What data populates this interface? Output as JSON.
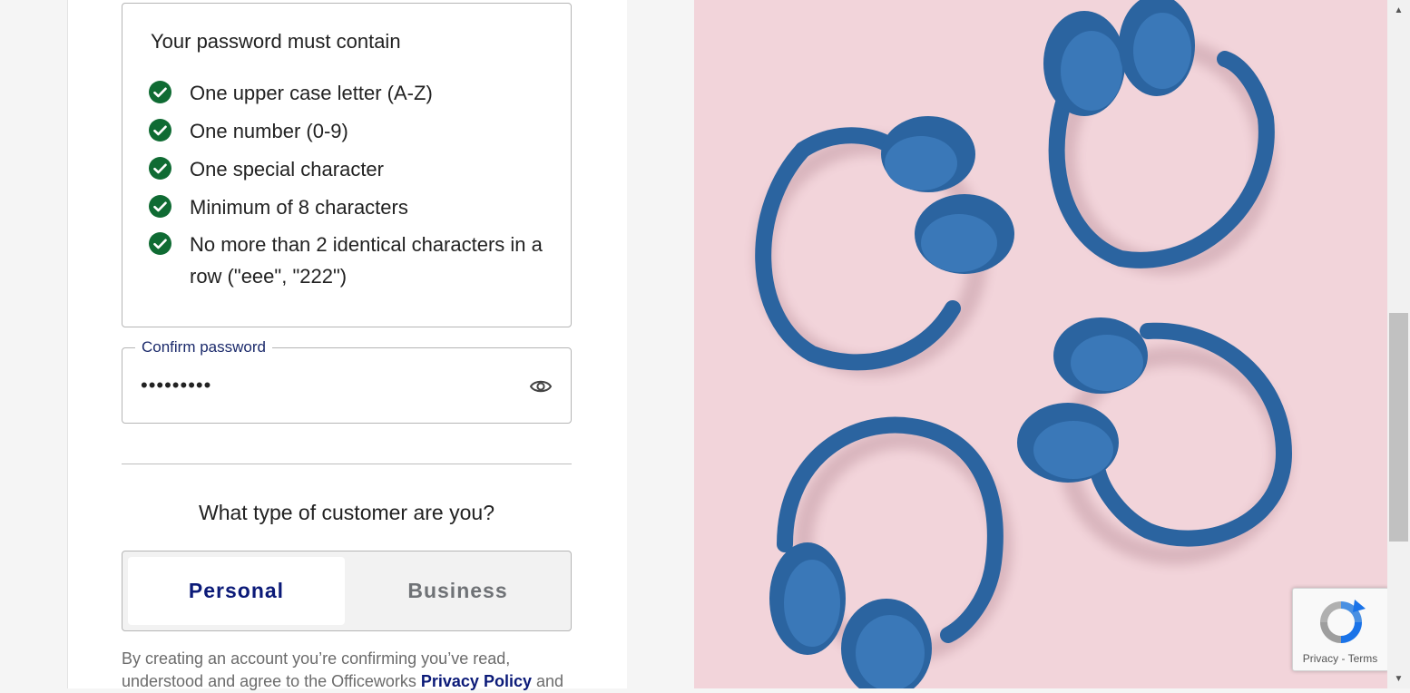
{
  "password_requirements": {
    "title": "Your password must contain",
    "items": [
      {
        "text": "One upper case letter (A-Z)"
      },
      {
        "text": "One number (0-9)"
      },
      {
        "text": "One special character"
      },
      {
        "text": "Minimum of 8 characters"
      },
      {
        "text": "No more than 2 identical characters in a row (\"eee\", \"222\")"
      }
    ]
  },
  "confirm_password": {
    "label": "Confirm password",
    "value": "•••••••••"
  },
  "customer_type": {
    "question": "What type of customer are you?",
    "options": [
      "Personal",
      "Business"
    ],
    "selected": "Personal"
  },
  "legal": {
    "prefix": "By creating an account you’re confirming you’ve read, understood and agree to the Officeworks",
    "privacy_link": "Privacy Policy",
    "suffix": "and"
  },
  "recaptcha": {
    "privacy": "Privacy",
    "separator": "-",
    "terms": "Terms"
  },
  "colors": {
    "check": "#0f6b33",
    "brand_navy": "#0b1a78",
    "hero_bg": "#f2d4da",
    "headphone_blue": "#2b64a0"
  },
  "icons": {
    "check": "check-circle-icon",
    "eye": "eye-icon",
    "recaptcha": "recaptcha-logo-icon"
  }
}
